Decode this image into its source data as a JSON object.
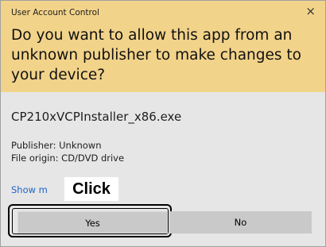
{
  "dialog": {
    "title": "User Account Control",
    "close_glyph": "×",
    "question": "Do you want to allow this app from an unknown publisher to make changes to your device?",
    "app_name": "CP210xVCPInstaller_x86.exe",
    "publisher": "Publisher: Unknown",
    "file_origin": "File origin: CD/DVD drive",
    "show_more": "Show m",
    "yes_label": "Yes",
    "no_label": "No"
  },
  "annotation": {
    "click_label": "Click"
  },
  "colors": {
    "header_bg": "#f2d38a",
    "body_bg": "#e6e6e6",
    "button_bg": "#c9c9c9",
    "link": "#1f63c9"
  }
}
